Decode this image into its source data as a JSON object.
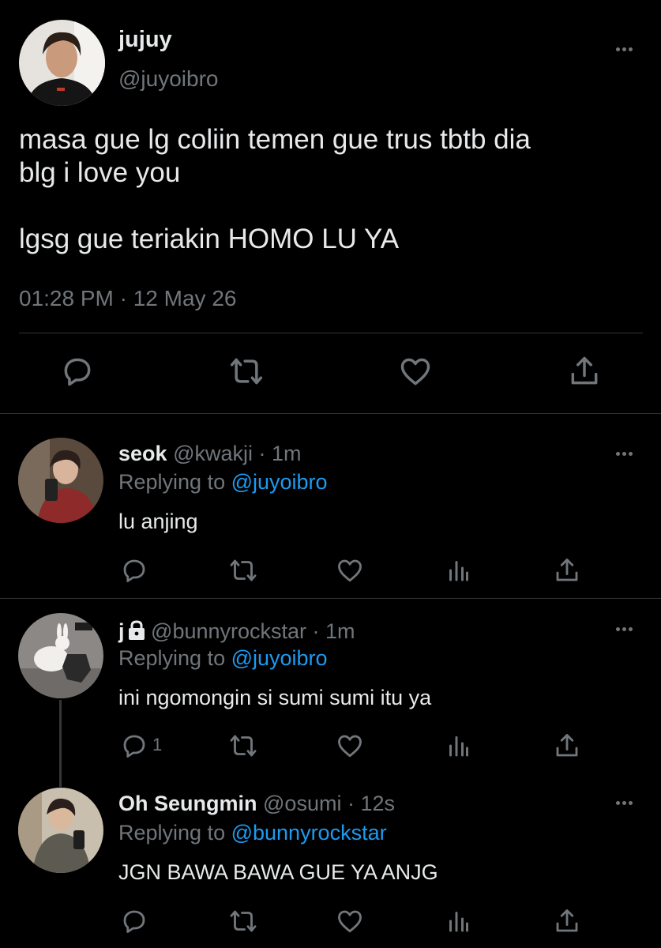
{
  "main": {
    "name": "jujuy",
    "handle": "@juyoibro",
    "text": "masa gue lg coliin temen gue trus tbtb dia\nblg i love you\n\nlgsg gue teriakin HOMO LU YA",
    "time": "01:28 PM · 12 May 26",
    "actions": [
      "reply-icon",
      "retweet-icon",
      "like-icon",
      "share-icon"
    ]
  },
  "replies": [
    {
      "name": "seok",
      "handle": "@kwakji",
      "time": "· 1m",
      "replying_prefix": "Replying to ",
      "replying_to": "@juyoibro",
      "text": "lu anjing",
      "reply_count": ""
    },
    {
      "name": "j",
      "handle": "@bunnyrockstar",
      "time": "· 1m",
      "replying_prefix": "Replying to ",
      "replying_to": "@juyoibro",
      "text": "ini ngomongin si sumi sumi itu ya",
      "reply_count": "1"
    },
    {
      "name": "Oh Seungmin",
      "handle": "@osumi",
      "time": "· 12s",
      "replying_prefix": "Replying to ",
      "replying_to": "@bunnyrockstar",
      "text": "JGN BAWA BAWA GUE YA ANJG",
      "reply_count": ""
    }
  ],
  "colors": {
    "background": "#000000",
    "text": "#e7e9ea",
    "muted": "#71767b",
    "link": "#1d9bf0",
    "divider": "#2f3336"
  }
}
